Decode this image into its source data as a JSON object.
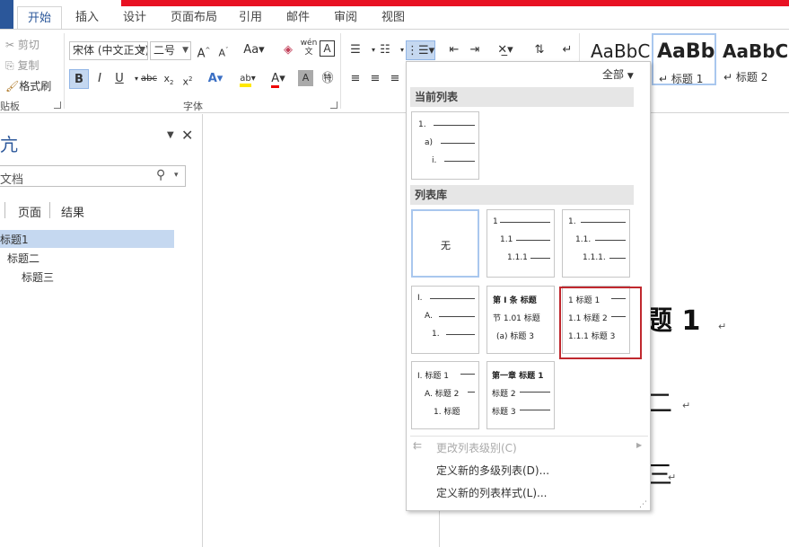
{
  "tabs": [
    "开始",
    "插入",
    "设计",
    "页面布局",
    "引用",
    "邮件",
    "审阅",
    "视图"
  ],
  "clipboard": {
    "cut": "剪切",
    "copy": "复制",
    "format_painter": "格式刷",
    "group_label": "贴板"
  },
  "font": {
    "name": "宋体 (中文正文)",
    "size": "二号",
    "group_label": "字体",
    "phonetic": "wén",
    "phonetic_char": "文"
  },
  "styles": [
    {
      "preview": "AaBbC",
      "name": ""
    },
    {
      "preview": "AaBb",
      "name": "标题 1"
    },
    {
      "preview": "AaBbC",
      "name": "标题 2"
    }
  ],
  "nav": {
    "title": "亢",
    "search_placeholder": "文档",
    "tabs": [
      "页面",
      "结果"
    ],
    "headings": [
      "标题1",
      "标题二",
      "标题三"
    ]
  },
  "document": {
    "lines": [
      "题 1",
      "二",
      "三"
    ],
    "para_mark": "↵"
  },
  "menu": {
    "filter": "全部",
    "current_header": "当前列表",
    "library_header": "列表库",
    "none_label": "无",
    "current": {
      "lines": [
        "1.",
        "a)",
        "i."
      ]
    },
    "lib1": {
      "lines": [
        "1",
        "1.1",
        "1.1.1"
      ]
    },
    "lib2": {
      "lines": [
        "1.",
        "1.1.",
        "1.1.1."
      ]
    },
    "lib3": {
      "lines": [
        "I.",
        "A.",
        "1."
      ]
    },
    "lib4": {
      "lines": [
        "第 Ⅰ 条 标题",
        "节 1.01 标题",
        "(a) 标题 3"
      ]
    },
    "lib5": {
      "lines": [
        "1 标题 1",
        "1.1 标题 2",
        "1.1.1 标题 3"
      ]
    },
    "lib6": {
      "lines": [
        "Ⅰ. 标题 1",
        "A. 标题 2",
        "1. 标题"
      ]
    },
    "lib7": {
      "lines": [
        "第一章 标题 1",
        "标题 2",
        "标题 3"
      ]
    },
    "items": [
      "更改列表级别(C)",
      "定义新的多级列表(D)...",
      "定义新的列表样式(L)..."
    ]
  }
}
